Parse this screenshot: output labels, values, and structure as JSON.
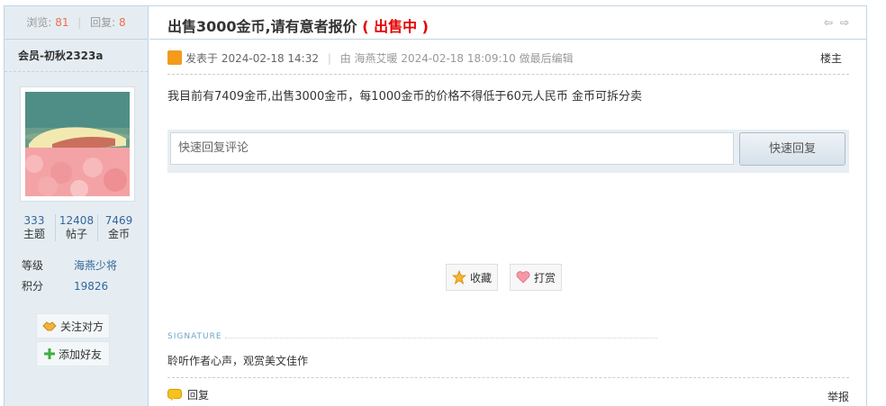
{
  "sidebar": {
    "views_label": "浏览:",
    "views_value": "81",
    "replies_label": "回复:",
    "replies_value": "8",
    "username": "会员-初秋2323a",
    "counts": [
      {
        "value": "333",
        "label": "主题"
      },
      {
        "value": "12408",
        "label": "帖子"
      },
      {
        "value": "7469",
        "label": "金币"
      }
    ],
    "level_label": "等级",
    "level_value": "海燕少将",
    "points_label": "积分",
    "points_value": "19826",
    "follow_label": "关注对方",
    "add_friend_label": "添加好友"
  },
  "post": {
    "title": "出售3000金币,请有意者报价",
    "status": "( 出售中 )",
    "posted_prefix": "发表于",
    "posted_time": "2024-02-18 14:32",
    "edit_note": "由 海燕艾暖 2024-02-18 18:09:10 做最后编辑",
    "floor": "楼主",
    "content": "我目前有7409金币,出售3000金币，每1000金币的价格不得低于60元人民币 金币可拆分卖"
  },
  "quick_reply": {
    "placeholder": "快速回复评论",
    "button": "快速回复"
  },
  "actions": {
    "favorite": "收藏",
    "tip": "打赏"
  },
  "signature": {
    "label": "SIGNATURE",
    "text": "聆听作者心声，观赏美文佳作"
  },
  "footer": {
    "reply": "回复",
    "report": "举报"
  },
  "colors": {
    "status_red": "#e60000",
    "link_blue": "#336699",
    "sidebar_bg": "#e5edf2"
  }
}
